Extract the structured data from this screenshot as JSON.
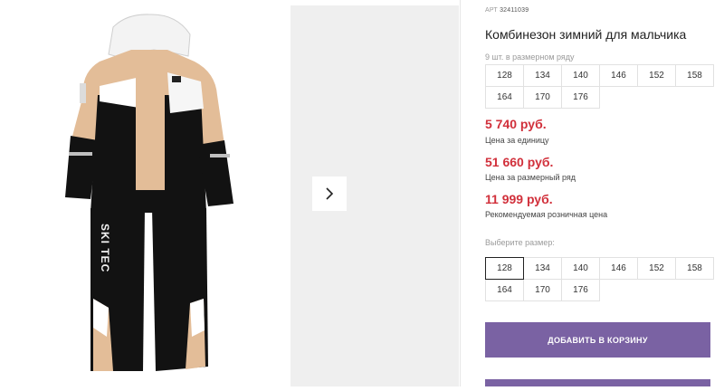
{
  "product": {
    "art_prefix": "АРТ",
    "art_number": "32411039",
    "title": "Комбинезон зимний для мальчика"
  },
  "pack": {
    "label": "9 шт. в размерном ряду",
    "sizes": [
      "128",
      "134",
      "140",
      "146",
      "152",
      "158",
      "164",
      "170",
      "176"
    ]
  },
  "prices": {
    "unit_price": "5 740 руб.",
    "unit_label": "Цена за единицу",
    "row_price": "51 660 руб.",
    "row_label": "Цена за размерный ряд",
    "retail_price": "11 999 руб.",
    "retail_label": "Рекомендуемая розничная цена"
  },
  "size_select": {
    "label": "Выберите размер:",
    "sizes": [
      "128",
      "134",
      "140",
      "146",
      "152",
      "158",
      "164",
      "170",
      "176"
    ],
    "selected": "128"
  },
  "cart": {
    "add_label": "ДОБАВИТЬ В КОРЗИНУ"
  },
  "garment": {
    "print_text": "SKI TEC"
  },
  "colors": {
    "price": "#d1303b",
    "button": "#7a62a3",
    "jacket_beige": "#e3bd98",
    "jacket_black": "#121212"
  }
}
